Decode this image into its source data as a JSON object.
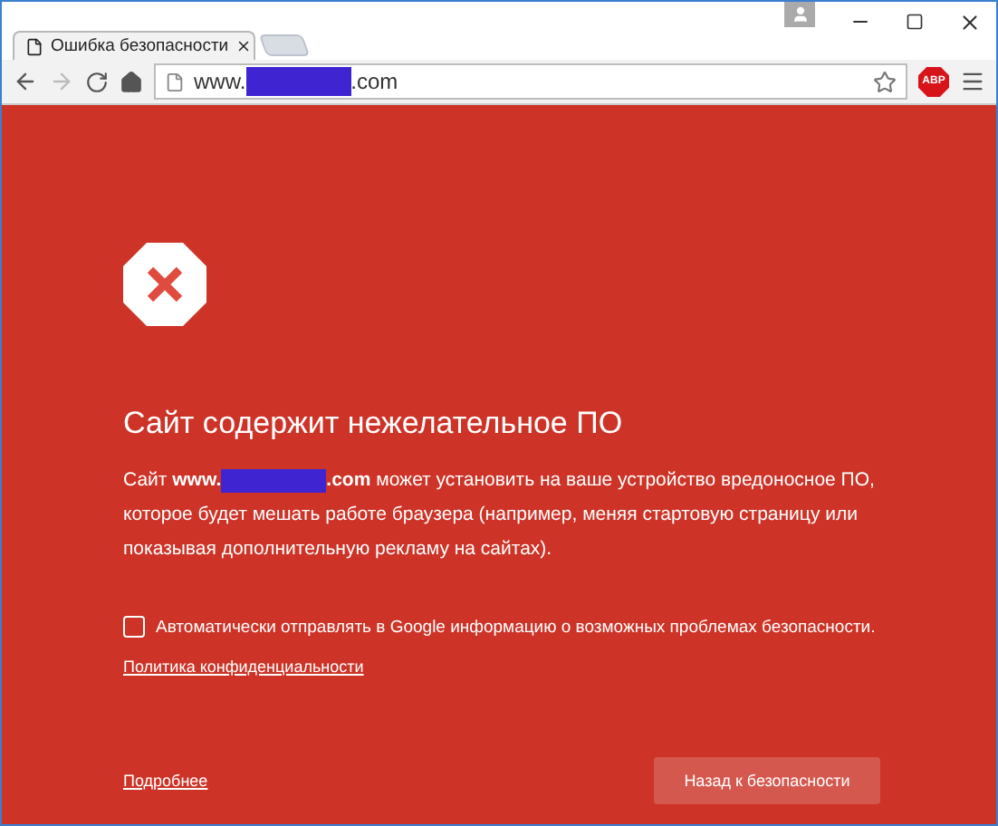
{
  "tabs": [
    {
      "title": "Ошибка безопасности",
      "selected": true
    }
  ],
  "address_bar": {
    "url_prefix": "www.",
    "url_suffix": ".com"
  },
  "extension": {
    "label": "ABP"
  },
  "warning": {
    "title": "Сайт содержит нежелательное ПО",
    "text_before": "Сайт **www.**",
    "text_after": "**.com** может установить на ваше устройство вредоносное ПО, которое будет мешать работе браузера (например, меняя стартовую страницу или показывая дополнительную рекламу на сайтах).",
    "report_checkbox": {
      "label": "Автоматически отправлять в Google информацию о возможных проблемах безопасности.",
      "checked": false
    },
    "privacy_link": "Политика конфиденциальности",
    "details_link": "Подробнее",
    "back_button": "Назад к безопасности"
  }
}
